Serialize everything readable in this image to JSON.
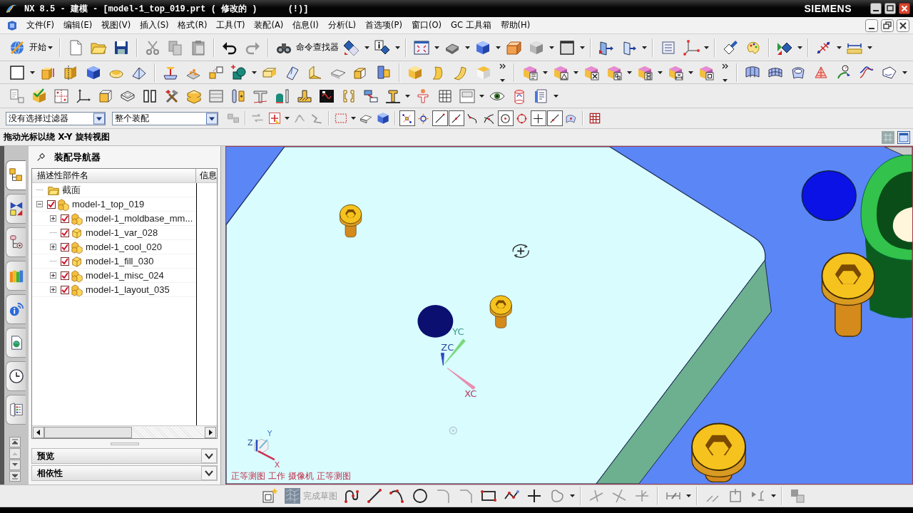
{
  "window": {
    "title": "NX 8.5 - 建模 - [model-1_top_019.prt ( 修改的 )      (!)]",
    "brand": "SIEMENS"
  },
  "menu_bar": [
    "文件(F)",
    "编辑(E)",
    "视图(V)",
    "插入(S)",
    "格式(R)",
    "工具(T)",
    "装配(A)",
    "信息(I)",
    "分析(L)",
    "首选项(P)",
    "窗口(O)",
    "GC 工具箱",
    "帮助(H)"
  ],
  "toolbar": {
    "start_button": "开始",
    "command_finder": "命令查找器"
  },
  "selection_bar": {
    "type_filter": "没有选择过滤器",
    "scope": "整个装配",
    "snap_points": [
      {
        "on": true
      },
      {
        "on": false
      },
      {
        "on": true
      },
      {
        "on": true
      },
      {
        "on": false
      },
      {
        "on": false
      },
      {
        "on": true
      },
      {
        "on": false
      },
      {
        "on": true
      },
      {
        "on": true
      },
      {
        "on": false
      }
    ]
  },
  "cue_line": "拖动光标以绕 X-Y 旋转视图",
  "resource_bar": {
    "tabs": [
      {
        "selected": true
      },
      {
        "selected": false
      },
      {
        "selected": false
      },
      {
        "selected": false
      },
      {
        "selected": false
      },
      {
        "selected": false
      },
      {
        "selected": false
      },
      {
        "selected": false
      }
    ]
  },
  "assembly_navigator": {
    "title": "装配导航器",
    "columns": [
      "描述性部件名",
      "信息"
    ],
    "tree": [
      {
        "label": "截面",
        "kind": "folder"
      },
      {
        "label": "model-1_top_019",
        "kind": "assembly",
        "checked": true,
        "expanded": true,
        "children": [
          {
            "label": "model-1_moldbase_mm...",
            "kind": "assembly",
            "checked": true,
            "expanded": false
          },
          {
            "label": "model-1_var_028",
            "kind": "part",
            "checked": true
          },
          {
            "label": "model-1_cool_020",
            "kind": "assembly",
            "checked": true,
            "expanded": false
          },
          {
            "label": "model-1_fill_030",
            "kind": "part",
            "checked": true
          },
          {
            "label": "model-1_misc_024",
            "kind": "assembly",
            "checked": true,
            "expanded": false
          },
          {
            "label": "model-1_layout_035",
            "kind": "assembly",
            "checked": true,
            "expanded": false
          }
        ]
      }
    ]
  },
  "panels": [
    {
      "title": "预览",
      "expanded": false
    },
    {
      "title": "相依性",
      "expanded": false
    }
  ],
  "viewport": {
    "wcs_labels": [
      "XC",
      "YC",
      "ZC"
    ],
    "triad_labels": [
      "X",
      "Y",
      "Z"
    ],
    "view_label": "正等测图 工作 摄像机 正等测图"
  },
  "sketch_toolbar": {
    "finish_sketch": {
      "label": "完成草图",
      "disabled": true
    }
  }
}
